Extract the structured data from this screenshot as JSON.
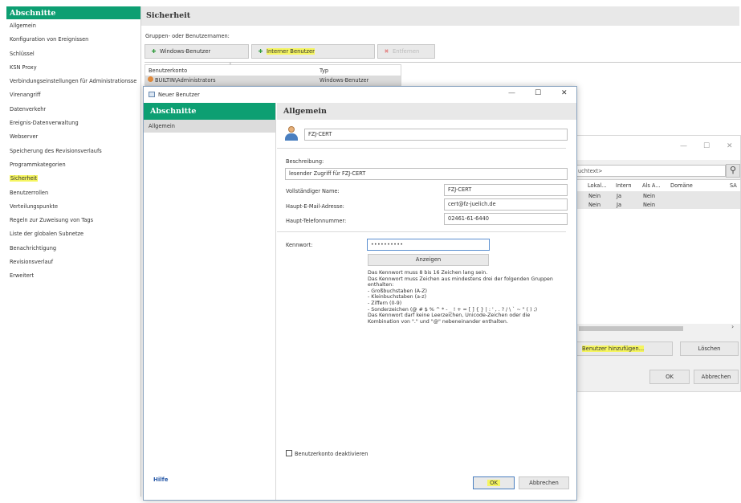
{
  "sidebar": {
    "title": "Abschnitte",
    "items": [
      {
        "label": "Allgemein"
      },
      {
        "label": "Konfiguration von Ereignissen"
      },
      {
        "label": "Schlüssel"
      },
      {
        "label": "KSN Proxy"
      },
      {
        "label": "Verbindungseinstellungen für Administrationsse"
      },
      {
        "label": "Virenangriff"
      },
      {
        "label": "Datenverkehr"
      },
      {
        "label": "Ereignis-Datenverwaltung"
      },
      {
        "label": "Webserver"
      },
      {
        "label": "Speicherung des Revisionsverlaufs"
      },
      {
        "label": "Programmkategorien"
      },
      {
        "label": "Sicherheit"
      },
      {
        "label": "Benutzerrollen"
      },
      {
        "label": "Verteilungspunkte"
      },
      {
        "label": "Regeln zur Zuweisung von Tags"
      },
      {
        "label": "Liste der globalen Subnetze"
      },
      {
        "label": "Benachrichtigung"
      },
      {
        "label": "Revisionsverlauf"
      },
      {
        "label": "Erweitert"
      }
    ]
  },
  "main": {
    "title": "Sicherheit",
    "group_label": "Gruppen- oder Benutzernamen:",
    "buttons": {
      "windows_user": "Windows-Benutzer",
      "internal_user": "Interner Benutzer",
      "remove": "Entfernen"
    },
    "columns": [
      "Benutzerkonto",
      "Typ"
    ],
    "rows": [
      {
        "account": "BUILTIN\\Administrators",
        "type": "Windows-Benutzer"
      }
    ]
  },
  "background_dialog": {
    "search_placeholder": "uchtext>",
    "columns": [
      "Lokal...",
      "Intern",
      "Als A...",
      "Domäne",
      "SA"
    ],
    "rows": [
      [
        "Nein",
        "Ja",
        "Nein"
      ],
      [
        "Nein",
        "Ja",
        "Nein"
      ]
    ],
    "add_user_button": "Benutzer hinzufügen...",
    "delete_button": "Löschen",
    "ok_button": "OK",
    "cancel_button": "Abbrechen"
  },
  "dialog": {
    "title": "Neuer Benutzer",
    "sections_title": "Abschnitte",
    "sections": [
      {
        "label": "Allgemein"
      }
    ],
    "section_header": "Allgemein",
    "username": "FZJ-CERT",
    "description_label": "Beschreibung:",
    "description": "lesender Zugriff für FZJ-CERT",
    "fullname_label": "Vollständiger Name:",
    "fullname": "FZJ-CERT",
    "email_label": "Haupt-E-Mail-Adresse:",
    "email": "cert@fz-juelich.de",
    "phone_label": "Haupt-Telefonnummer:",
    "phone": "02461-61-6440",
    "password_label": "Kennwort:",
    "password_mask": "••••••••••",
    "show_button": "Anzeigen",
    "password_rules": [
      "Das Kennwort muss 8 bis 16 Zeichen lang sein.",
      "Das Kennwort muss Zeichen aus mindestens drei der folgenden Gruppen",
      "enthalten:",
      "- Großbuchstaben (A-Z)",
      "- Kleinbuchstaben (a-z)",
      "- Ziffern (0-9)",
      "- Sonderzeichen (@ # $ % ^ * - _ ! + = [ ] { } | : ' , . ? / \\ ` ~ \" ( ) ;)",
      "Das Kennwort darf keine Leerzeichen, Unicode-Zeichen oder die",
      "Kombination von \".\" und \"@\" nebeneinander enthalten."
    ],
    "disable_account_label": "Benutzerkonto deaktivieren",
    "help_link": "Hilfe",
    "ok_button": "OK",
    "cancel_button": "Abbrechen"
  }
}
